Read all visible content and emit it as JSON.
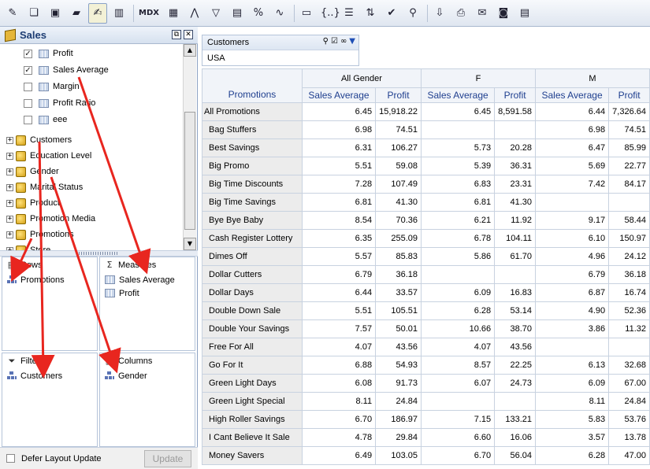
{
  "toolbar": {
    "buttons": [
      {
        "name": "new-report-icon",
        "glyph": "✎"
      },
      {
        "name": "open-icon",
        "glyph": "❏"
      },
      {
        "name": "save-icon",
        "glyph": "▣"
      },
      {
        "name": "folder-icon",
        "glyph": "▰"
      },
      {
        "name": "edit-layout-icon",
        "glyph": "✍",
        "active": true
      },
      {
        "name": "chart-icon",
        "glyph": "▥"
      },
      {
        "name": "mdx-button",
        "label": "MDX"
      },
      {
        "name": "grid-icon",
        "glyph": "▦"
      },
      {
        "name": "hierarchy-icon",
        "glyph": "⋀"
      },
      {
        "name": "filter-icon",
        "glyph": "▽"
      },
      {
        "name": "drill-icon",
        "glyph": "▤"
      },
      {
        "name": "percent-icon",
        "glyph": "%"
      },
      {
        "name": "sparkline-icon",
        "glyph": "∿"
      },
      {
        "name": "calculator-icon",
        "glyph": "▭"
      },
      {
        "name": "braces-icon",
        "glyph": "{..}"
      },
      {
        "name": "properties-icon",
        "glyph": "☰"
      },
      {
        "name": "swap-axes-icon",
        "glyph": "⇅"
      },
      {
        "name": "check-icon",
        "glyph": "✔"
      },
      {
        "name": "zoom-icon",
        "glyph": "⚲"
      },
      {
        "name": "export-icon",
        "glyph": "⇩"
      },
      {
        "name": "print-icon",
        "glyph": "⎙"
      },
      {
        "name": "mail-icon",
        "glyph": "✉"
      },
      {
        "name": "camera-icon",
        "glyph": "◙"
      },
      {
        "name": "document-icon",
        "glyph": "▤"
      }
    ]
  },
  "cube": {
    "title": "Sales"
  },
  "tree": {
    "measures": [
      {
        "label": "Profit",
        "checked": true
      },
      {
        "label": "Sales Average",
        "checked": true
      },
      {
        "label": "Margin",
        "checked": false
      },
      {
        "label": "Profit Ratio",
        "checked": false
      },
      {
        "label": "eee",
        "checked": false
      }
    ],
    "dimensions": [
      "Customers",
      "Education Level",
      "Gender",
      "Marital Status",
      "Product",
      "Promotion Media",
      "Promotions",
      "Store"
    ]
  },
  "zones": {
    "rows": {
      "title": "Rows",
      "items": [
        "Promotions"
      ]
    },
    "measures": {
      "title": "Measures",
      "items": [
        "Sales Average",
        "Profit"
      ]
    },
    "filters": {
      "title": "Filters",
      "items": [
        "Customers"
      ]
    },
    "columns": {
      "title": "Columns",
      "items": [
        "Gender"
      ]
    }
  },
  "bottom": {
    "defer_label": "Defer Layout Update",
    "update_label": "Update"
  },
  "filter": {
    "dimension": "Customers",
    "value": "USA"
  },
  "grid": {
    "row_header": "Promotions",
    "groups": [
      "All Gender",
      "F",
      "M"
    ],
    "measures": [
      "Sales Average",
      "Profit"
    ],
    "rows": [
      {
        "label": "All Promotions",
        "values": [
          "6.45",
          "15,918.22",
          "6.45",
          "8,591.58",
          "6.44",
          "7,326.64"
        ]
      },
      {
        "label": "Bag Stuffers",
        "values": [
          "6.98",
          "74.51",
          "",
          "",
          "6.98",
          "74.51"
        ]
      },
      {
        "label": "Best Savings",
        "values": [
          "6.31",
          "106.27",
          "5.73",
          "20.28",
          "6.47",
          "85.99"
        ]
      },
      {
        "label": "Big Promo",
        "values": [
          "5.51",
          "59.08",
          "5.39",
          "36.31",
          "5.69",
          "22.77"
        ]
      },
      {
        "label": "Big Time Discounts",
        "values": [
          "7.28",
          "107.49",
          "6.83",
          "23.31",
          "7.42",
          "84.17"
        ]
      },
      {
        "label": "Big Time Savings",
        "values": [
          "6.81",
          "41.30",
          "6.81",
          "41.30",
          "",
          ""
        ]
      },
      {
        "label": "Bye Bye Baby",
        "values": [
          "8.54",
          "70.36",
          "6.21",
          "11.92",
          "9.17",
          "58.44"
        ]
      },
      {
        "label": "Cash Register Lottery",
        "values": [
          "6.35",
          "255.09",
          "6.78",
          "104.11",
          "6.10",
          "150.97"
        ]
      },
      {
        "label": "Dimes Off",
        "values": [
          "5.57",
          "85.83",
          "5.86",
          "61.70",
          "4.96",
          "24.12"
        ]
      },
      {
        "label": "Dollar Cutters",
        "values": [
          "6.79",
          "36.18",
          "",
          "",
          "6.79",
          "36.18"
        ]
      },
      {
        "label": "Dollar Days",
        "values": [
          "6.44",
          "33.57",
          "6.09",
          "16.83",
          "6.87",
          "16.74"
        ]
      },
      {
        "label": "Double Down Sale",
        "values": [
          "5.51",
          "105.51",
          "6.28",
          "53.14",
          "4.90",
          "52.36"
        ]
      },
      {
        "label": "Double Your Savings",
        "values": [
          "7.57",
          "50.01",
          "10.66",
          "38.70",
          "3.86",
          "11.32"
        ]
      },
      {
        "label": "Free For All",
        "values": [
          "4.07",
          "43.56",
          "4.07",
          "43.56",
          "",
          ""
        ]
      },
      {
        "label": "Go For It",
        "values": [
          "6.88",
          "54.93",
          "8.57",
          "22.25",
          "6.13",
          "32.68"
        ]
      },
      {
        "label": "Green Light Days",
        "values": [
          "6.08",
          "91.73",
          "6.07",
          "24.73",
          "6.09",
          "67.00"
        ]
      },
      {
        "label": "Green Light Special",
        "values": [
          "8.11",
          "24.84",
          "",
          "",
          "8.11",
          "24.84"
        ]
      },
      {
        "label": "High Roller Savings",
        "values": [
          "6.70",
          "186.97",
          "7.15",
          "133.21",
          "5.83",
          "53.76"
        ]
      },
      {
        "label": "I Cant Believe It Sale",
        "values": [
          "4.78",
          "29.84",
          "6.60",
          "16.06",
          "3.57",
          "13.78"
        ]
      },
      {
        "label": "Money Savers",
        "values": [
          "6.49",
          "103.05",
          "6.70",
          "56.04",
          "6.28",
          "47.00"
        ]
      }
    ]
  }
}
